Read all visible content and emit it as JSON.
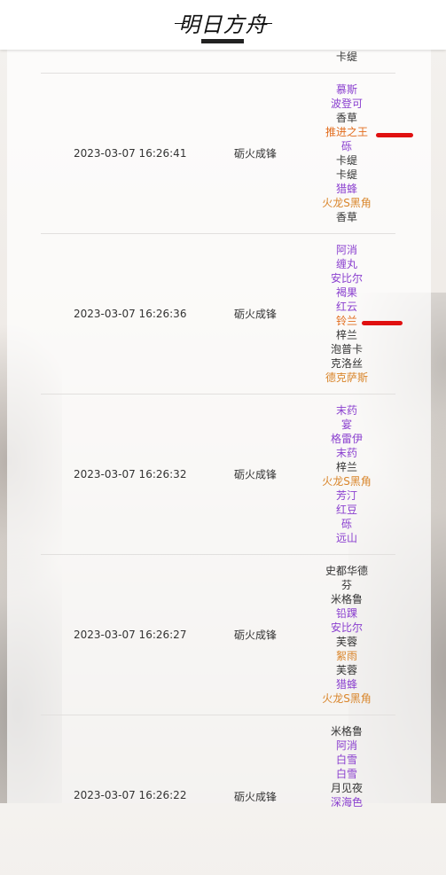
{
  "header": {
    "logo_text": "明日方舟",
    "logo_icon": "arknights-logo-icon"
  },
  "pool_name": "砺火成锋",
  "colors": {
    "rarity_3": "#333333",
    "rarity_4": "#8a3fcf",
    "rarity_5": "#d9852a",
    "rarity_6": "#e26d1e",
    "highlight_mark": "#e01010"
  },
  "records": [
    {
      "time": "",
      "pool": "",
      "names": [
        {
          "name": "卡缇",
          "rarity": 3
        }
      ]
    },
    {
      "time": "2023-03-07 16:26:41",
      "pool": "砺火成锋",
      "names": [
        {
          "name": "慕斯",
          "rarity": 4
        },
        {
          "name": "波登可",
          "rarity": 4
        },
        {
          "name": "香草",
          "rarity": 3
        },
        {
          "name": "推进之王",
          "rarity": 6
        },
        {
          "name": "砾",
          "rarity": 4
        },
        {
          "name": "卡缇",
          "rarity": 3
        },
        {
          "name": "卡缇",
          "rarity": 3
        },
        {
          "name": "猎蜂",
          "rarity": 4
        },
        {
          "name": "火龙S黑角",
          "rarity": 5
        },
        {
          "name": "香草",
          "rarity": 3
        }
      ]
    },
    {
      "time": "2023-03-07 16:26:36",
      "pool": "砺火成锋",
      "names": [
        {
          "name": "阿消",
          "rarity": 4
        },
        {
          "name": "缠丸",
          "rarity": 4
        },
        {
          "name": "安比尔",
          "rarity": 4
        },
        {
          "name": "褐果",
          "rarity": 4
        },
        {
          "name": "红云",
          "rarity": 4
        },
        {
          "name": "铃兰",
          "rarity": 6
        },
        {
          "name": "梓兰",
          "rarity": 3
        },
        {
          "name": "泡普卡",
          "rarity": 3
        },
        {
          "name": "克洛丝",
          "rarity": 3
        },
        {
          "name": "德克萨斯",
          "rarity": 5
        }
      ]
    },
    {
      "time": "2023-03-07 16:26:32",
      "pool": "砺火成锋",
      "names": [
        {
          "name": "末药",
          "rarity": 4
        },
        {
          "name": "宴",
          "rarity": 4
        },
        {
          "name": "格雷伊",
          "rarity": 4
        },
        {
          "name": "末药",
          "rarity": 4
        },
        {
          "name": "梓兰",
          "rarity": 3
        },
        {
          "name": "火龙S黑角",
          "rarity": 5
        },
        {
          "name": "芳汀",
          "rarity": 4
        },
        {
          "name": "红豆",
          "rarity": 4
        },
        {
          "name": "砾",
          "rarity": 4
        },
        {
          "name": "远山",
          "rarity": 4
        }
      ]
    },
    {
      "time": "2023-03-07 16:26:27",
      "pool": "砺火成锋",
      "names": [
        {
          "name": "史都华德",
          "rarity": 3
        },
        {
          "name": "芬",
          "rarity": 3
        },
        {
          "name": "米格鲁",
          "rarity": 3
        },
        {
          "name": "铅踝",
          "rarity": 4
        },
        {
          "name": "安比尔",
          "rarity": 4
        },
        {
          "name": "芙蓉",
          "rarity": 3
        },
        {
          "name": "絮雨",
          "rarity": 5
        },
        {
          "name": "芙蓉",
          "rarity": 3
        },
        {
          "name": "猎蜂",
          "rarity": 4
        },
        {
          "name": "火龙S黑角",
          "rarity": 5
        }
      ]
    },
    {
      "time": "2023-03-07 16:26:22",
      "pool": "砺火成锋",
      "names": [
        {
          "name": "米格鲁",
          "rarity": 3
        },
        {
          "name": "阿消",
          "rarity": 4
        },
        {
          "name": "白雪",
          "rarity": 4
        },
        {
          "name": "白雪",
          "rarity": 4
        },
        {
          "name": "月见夜",
          "rarity": 3
        },
        {
          "name": "深海色",
          "rarity": 4
        }
      ]
    }
  ]
}
